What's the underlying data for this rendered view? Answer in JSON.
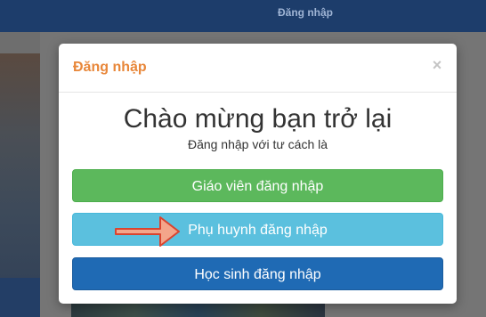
{
  "header": {
    "login_link": "Đăng nhập"
  },
  "modal": {
    "title": "Đăng nhập",
    "close_label": "×",
    "welcome": "Chào mừng bạn trở lại",
    "subtitle": "Đăng nhập với tư cách là",
    "buttons": {
      "teacher": "Giáo viên đăng nhập",
      "parent": "Phụ huynh đăng nhập",
      "student": "Học sinh đăng nhập"
    }
  },
  "colors": {
    "title_orange": "#e8873a",
    "teacher_green": "#5cb85c",
    "parent_cyan": "#5bc0de",
    "student_blue": "#1f6ab4",
    "arrow_fill": "#f4a58a",
    "arrow_stroke": "#d9442f"
  },
  "icons": {
    "pointer_arrow": "arrow-right-icon",
    "close": "close-icon"
  }
}
